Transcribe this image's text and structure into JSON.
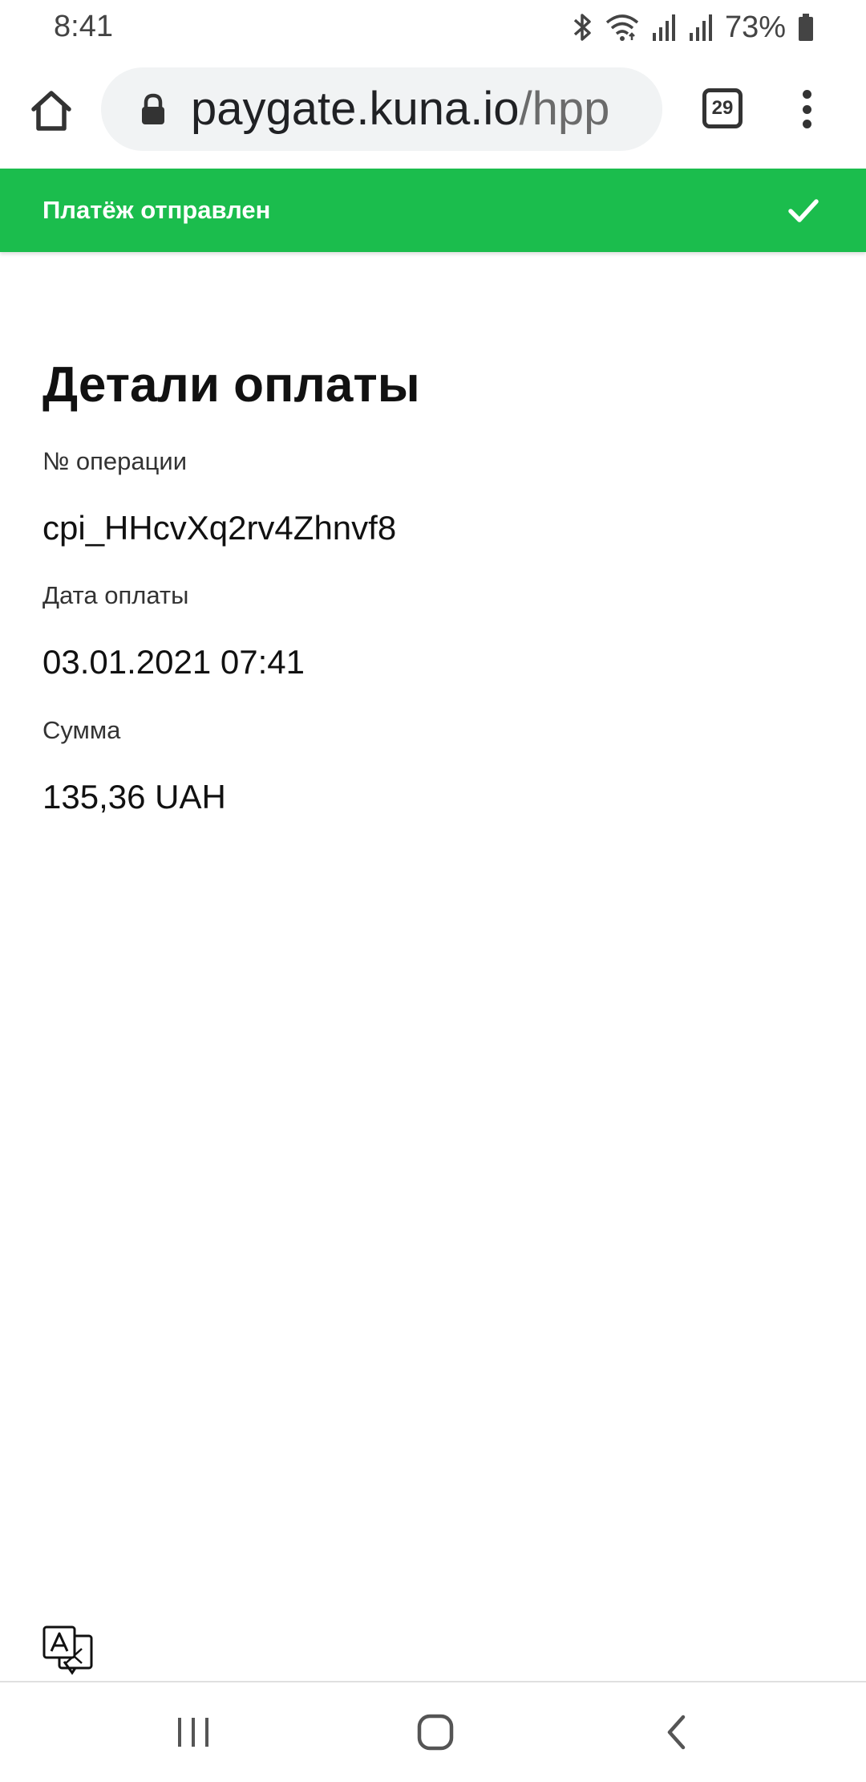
{
  "status_bar": {
    "time": "8:41",
    "battery_percent": "73%",
    "icons": [
      "bluetooth-icon",
      "wifi-icon",
      "signal-icon",
      "signal-icon",
      "battery-icon"
    ]
  },
  "browser": {
    "url_host": "paygate.kuna.io",
    "url_path": "/hpp",
    "tab_count": "29"
  },
  "banner": {
    "message": "Платёж отправлен",
    "color": "#1bbd4d",
    "icon": "check-icon"
  },
  "details": {
    "title": "Детали оплаты",
    "fields": [
      {
        "label": "№ операции",
        "value": "cpi_HHcvXq2rv4Zhnvf8"
      },
      {
        "label": "Дата оплаты",
        "value": "03.01.2021 07:41"
      },
      {
        "label": "Сумма",
        "value": "135,36 UAH"
      }
    ]
  },
  "footer": {
    "icon": "translate-icon"
  },
  "nav": {
    "icons": [
      "recents-icon",
      "home-icon",
      "back-icon"
    ]
  }
}
